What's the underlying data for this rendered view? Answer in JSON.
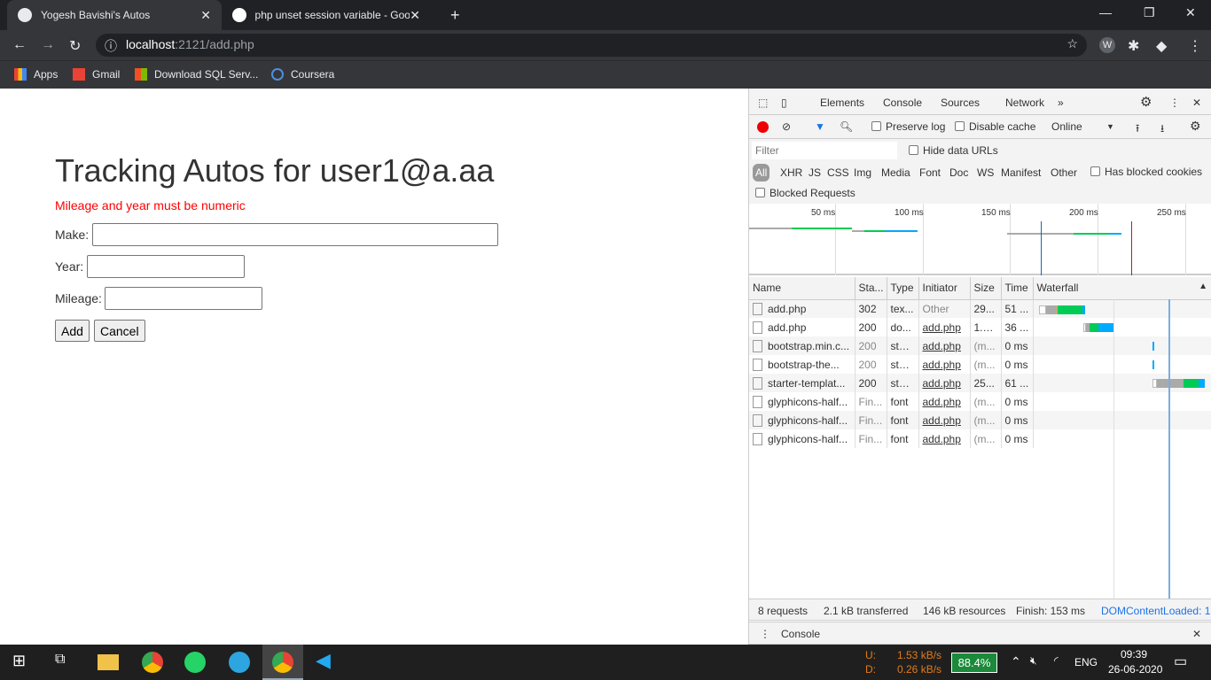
{
  "browser": {
    "tabs": [
      {
        "title": "Yogesh Bavishi's Autos",
        "active": true
      },
      {
        "title": "php unset session variable - Goo",
        "active": false
      }
    ],
    "new_tab": "+",
    "url_host": "localhost",
    "url_rest": ":2121/add.php",
    "bookmarks": [
      "Apps",
      "Gmail",
      "Download SQL Serv...",
      "Coursera"
    ],
    "profile_initial": "W"
  },
  "page": {
    "title": "Tracking Autos for user1@a.aa",
    "error": "Mileage and year must be numeric",
    "make_label": "Make:",
    "year_label": "Year:",
    "mileage_label": "Mileage:",
    "make_value": "",
    "year_value": "",
    "mileage_value": "",
    "add_button": "Add",
    "cancel_button": "Cancel"
  },
  "devtools": {
    "tabs": [
      "Elements",
      "Console",
      "Sources",
      "Network"
    ],
    "active_tab": "Network",
    "more": "»",
    "preserve_log": "Preserve log",
    "disable_cache": "Disable cache",
    "throttle": "Online",
    "filter_placeholder": "Filter",
    "hide_data_urls": "Hide data URLs",
    "types": [
      "All",
      "XHR",
      "JS",
      "CSS",
      "Img",
      "Media",
      "Font",
      "Doc",
      "WS",
      "Manifest",
      "Other"
    ],
    "has_blocked_cookies": "Has blocked cookies",
    "blocked_requests": "Blocked Requests",
    "overview_ticks": [
      "50 ms",
      "100 ms",
      "150 ms",
      "200 ms",
      "250 ms"
    ],
    "columns": [
      "Name",
      "Sta...",
      "Type",
      "Initiator",
      "Size",
      "Time",
      "Waterfall"
    ],
    "rows": [
      {
        "name": "add.php",
        "status": "302",
        "type": "tex...",
        "initiator": "Other",
        "size": "29...",
        "time": "51 ..."
      },
      {
        "name": "add.php",
        "status": "200",
        "type": "do...",
        "initiator": "add.php",
        "size": "1.6...",
        "time": "36 ..."
      },
      {
        "name": "bootstrap.min.c...",
        "status": "200",
        "type": "styl...",
        "initiator": "add.php",
        "size": "(m...",
        "time": "0 ms"
      },
      {
        "name": "bootstrap-the...",
        "status": "200",
        "type": "styl...",
        "initiator": "add.php",
        "size": "(m...",
        "time": "0 ms"
      },
      {
        "name": "starter-templat...",
        "status": "200",
        "type": "styl...",
        "initiator": "add.php",
        "size": "25...",
        "time": "61 ..."
      },
      {
        "name": "glyphicons-half...",
        "status": "Fin...",
        "type": "font",
        "initiator": "add.php",
        "size": "(m...",
        "time": "0 ms"
      },
      {
        "name": "glyphicons-half...",
        "status": "Fin...",
        "type": "font",
        "initiator": "add.php",
        "size": "(m...",
        "time": "0 ms"
      },
      {
        "name": "glyphicons-half...",
        "status": "Fin...",
        "type": "font",
        "initiator": "add.php",
        "size": "(m...",
        "time": "0 ms"
      }
    ],
    "summary": {
      "requests": "8 requests",
      "transferred": "2.1 kB transferred",
      "resources": "146 kB resources",
      "finish": "Finish: 153 ms",
      "dcl": "DOMContentLoaded: 1"
    },
    "drawer_tab": "Console"
  },
  "taskbar": {
    "up_label": "U:",
    "up": "1.53 kB/s",
    "down_label": "D:",
    "down": "0.26 kB/s",
    "battery": "88.4%",
    "lang": "ENG",
    "time": "09:39",
    "date": "26-06-2020"
  }
}
